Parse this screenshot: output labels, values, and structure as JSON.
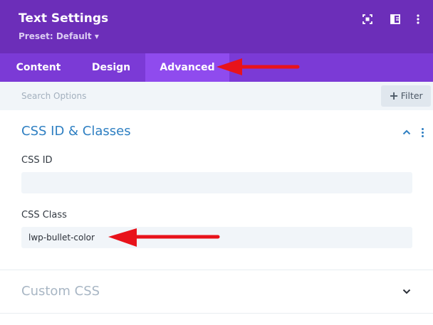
{
  "header": {
    "title": "Text Settings",
    "preset": "Preset: Default ▾",
    "icons": [
      "expand-icon",
      "sidebar-toggle-icon",
      "more-vertical-icon"
    ]
  },
  "tabs": [
    {
      "label": "Content",
      "active": false
    },
    {
      "label": "Design",
      "active": false
    },
    {
      "label": "Advanced",
      "active": true
    }
  ],
  "search": {
    "placeholder": "Search Options",
    "filter_label": "Filter"
  },
  "sections": {
    "css_id_classes": {
      "title": "CSS ID & Classes",
      "expanded": true,
      "fields": {
        "css_id": {
          "label": "CSS ID",
          "value": ""
        },
        "css_class": {
          "label": "CSS Class",
          "value": "lwp-bullet-color"
        }
      }
    },
    "custom_css": {
      "title": "Custom CSS",
      "expanded": false
    }
  },
  "colors": {
    "header_bg": "#6c2eb9",
    "tabs_bg": "#7b3ad6",
    "active_tab_bg": "#8f4bee",
    "section_title": "#2e7fc2",
    "annotation_arrow": "#e8131b"
  }
}
